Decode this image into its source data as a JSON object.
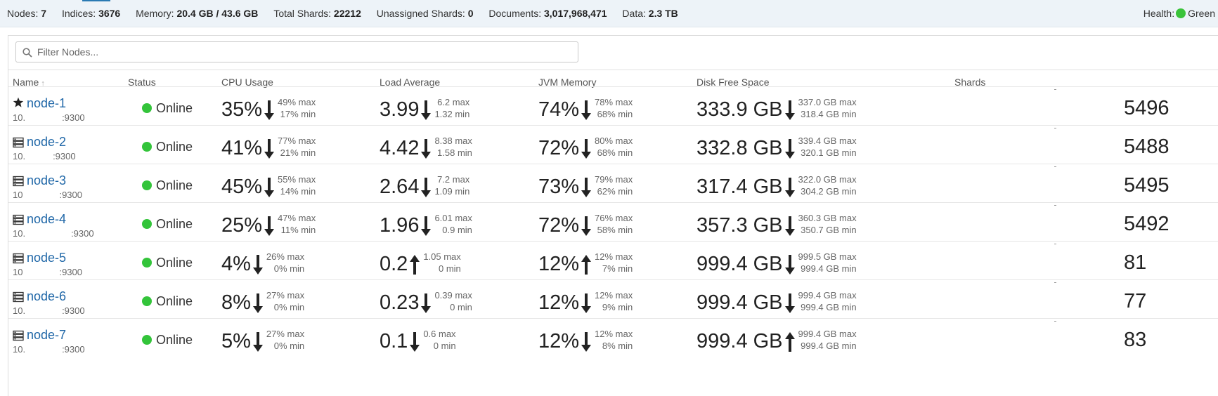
{
  "summary": {
    "nodes_label": "Nodes:",
    "nodes_value": "7",
    "indices_label": "Indices:",
    "indices_value": "3676",
    "memory_label": "Memory:",
    "memory_value": "20.4 GB / 43.6 GB",
    "total_shards_label": "Total Shards:",
    "total_shards_value": "22212",
    "unassigned_label": "Unassigned Shards:",
    "unassigned_value": "0",
    "documents_label": "Documents:",
    "documents_value": "3,017,968,471",
    "data_label": "Data:",
    "data_value": "2.3 TB",
    "health_label": "Health:",
    "health_value": "Green",
    "health_color": "#3ac33a"
  },
  "filter": {
    "placeholder": "Filter Nodes..."
  },
  "columns": {
    "name": "Name",
    "status": "Status",
    "cpu": "CPU Usage",
    "load": "Load Average",
    "jvm": "JVM Memory",
    "disk": "Disk Free Space",
    "shards": "Shards"
  },
  "nodes": [
    {
      "icon": "star-icon",
      "name": "node-1",
      "ip": "10.    :9300",
      "status": "Online",
      "cpu": {
        "value": "35%",
        "trend": "down",
        "max": "49% max",
        "min": "17% min"
      },
      "load": {
        "value": "3.99",
        "trend": "down",
        "max": "6.2 max",
        "min": "1.32 min"
      },
      "jvm": {
        "value": "74%",
        "trend": "down",
        "max": "78% max",
        "min": "68% min"
      },
      "disk": {
        "value": "333.9 GB",
        "trend": "down",
        "max": "337.0 GB max",
        "min": "318.4 GB min"
      },
      "shards": "5496"
    },
    {
      "icon": "server-icon",
      "name": "node-2",
      "ip": "10.   :9300",
      "status": "Online",
      "cpu": {
        "value": "41%",
        "trend": "down",
        "max": "77% max",
        "min": "21% min"
      },
      "load": {
        "value": "4.42",
        "trend": "down",
        "max": "8.38 max",
        "min": "1.58 min"
      },
      "jvm": {
        "value": "72%",
        "trend": "down",
        "max": "80% max",
        "min": "68% min"
      },
      "disk": {
        "value": "332.8 GB",
        "trend": "down",
        "max": "339.4 GB max",
        "min": "320.1 GB min"
      },
      "shards": "5488"
    },
    {
      "icon": "server-icon",
      "name": "node-3",
      "ip": "10    :9300",
      "status": "Online",
      "cpu": {
        "value": "45%",
        "trend": "down",
        "max": "55% max",
        "min": "14% min"
      },
      "load": {
        "value": "2.64",
        "trend": "down",
        "max": "7.2 max",
        "min": "1.09 min"
      },
      "jvm": {
        "value": "73%",
        "trend": "down",
        "max": "79% max",
        "min": "62% min"
      },
      "disk": {
        "value": "317.4 GB",
        "trend": "down",
        "max": "322.0 GB max",
        "min": "304.2 GB min"
      },
      "shards": "5495"
    },
    {
      "icon": "server-icon",
      "name": "node-4",
      "ip": "10.     :9300",
      "status": "Online",
      "cpu": {
        "value": "25%",
        "trend": "down",
        "max": "47% max",
        "min": "11% min"
      },
      "load": {
        "value": "1.96",
        "trend": "down",
        "max": "6.01 max",
        "min": "0.9 min"
      },
      "jvm": {
        "value": "72%",
        "trend": "down",
        "max": "76% max",
        "min": "58% min"
      },
      "disk": {
        "value": "357.3 GB",
        "trend": "down",
        "max": "360.3 GB max",
        "min": "350.7 GB min"
      },
      "shards": "5492"
    },
    {
      "icon": "server-icon",
      "name": "node-5",
      "ip": "10    :9300",
      "status": "Online",
      "cpu": {
        "value": "4%",
        "trend": "down",
        "max": "26% max",
        "min": "0% min"
      },
      "load": {
        "value": "0.2",
        "trend": "up",
        "max": "1.05 max",
        "min": "0 min"
      },
      "jvm": {
        "value": "12%",
        "trend": "up",
        "max": "12% max",
        "min": "7% min"
      },
      "disk": {
        "value": "999.4 GB",
        "trend": "down",
        "max": "999.5 GB max",
        "min": "999.4 GB min"
      },
      "shards": "81"
    },
    {
      "icon": "server-icon",
      "name": "node-6",
      "ip": "10.    :9300",
      "status": "Online",
      "cpu": {
        "value": "8%",
        "trend": "down",
        "max": "27% max",
        "min": "0% min"
      },
      "load": {
        "value": "0.23",
        "trend": "down",
        "max": "0.39 max",
        "min": "0 min"
      },
      "jvm": {
        "value": "12%",
        "trend": "down",
        "max": "12% max",
        "min": "9% min"
      },
      "disk": {
        "value": "999.4 GB",
        "trend": "down",
        "max": "999.4 GB max",
        "min": "999.4 GB min"
      },
      "shards": "77"
    },
    {
      "icon": "server-icon",
      "name": "node-7",
      "ip": "10.    :9300",
      "status": "Online",
      "cpu": {
        "value": "5%",
        "trend": "down",
        "max": "27% max",
        "min": "0% min"
      },
      "load": {
        "value": "0.1",
        "trend": "down",
        "max": "0.6 max",
        "min": "0 min"
      },
      "jvm": {
        "value": "12%",
        "trend": "down",
        "max": "12% max",
        "min": "8% min"
      },
      "disk": {
        "value": "999.4 GB",
        "trend": "up",
        "max": "999.4 GB max",
        "min": "999.4 GB min"
      },
      "shards": "83"
    }
  ]
}
